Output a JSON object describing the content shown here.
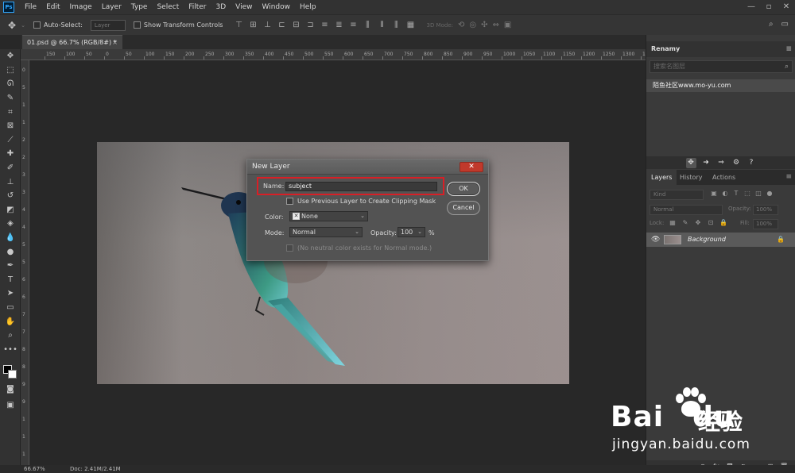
{
  "menubar": {
    "logo": "Ps",
    "items": [
      "File",
      "Edit",
      "Image",
      "Layer",
      "Type",
      "Select",
      "Filter",
      "3D",
      "View",
      "Window",
      "Help"
    ],
    "window_controls": [
      "—",
      "▫",
      "✕"
    ]
  },
  "options": {
    "auto_select_label": "Auto-Select:",
    "auto_select_value": "Layer",
    "show_transform_label": "Show Transform Controls",
    "mode_3d_label": "3D Mode:"
  },
  "document": {
    "tab_label": "01.psd @ 66.7% (RGB/8#) *",
    "tab_close": "×"
  },
  "ruler": {
    "h_ticks": [
      "150",
      "100",
      "50",
      "0",
      "50",
      "100",
      "150",
      "200",
      "250",
      "300",
      "350",
      "400",
      "450",
      "500",
      "550",
      "600",
      "650",
      "700",
      "750",
      "800",
      "850",
      "900",
      "950",
      "1000",
      "1050",
      "1100",
      "1150",
      "1200",
      "1250",
      "1300",
      "1350",
      "1400"
    ],
    "v_ticks": [
      "0",
      "5",
      "1",
      "1",
      "2",
      "2",
      "3",
      "3",
      "4",
      "4",
      "5",
      "5",
      "6",
      "6",
      "7",
      "7",
      "8",
      "8",
      "9",
      "9",
      "1",
      "1",
      "1"
    ]
  },
  "dialog": {
    "title": "New Layer",
    "close_label": "✕",
    "name_label": "Name:",
    "name_value": "subject",
    "ok_label": "OK",
    "cancel_label": "Cancel",
    "clipping_label": "Use Previous Layer to Create Clipping Mask",
    "color_label": "Color:",
    "color_value": "None",
    "mode_label": "Mode:",
    "mode_value": "Normal",
    "opacity_label": "Opacity:",
    "opacity_value": "100",
    "opacity_unit": "%",
    "neutral_label": "(No neutral color exists for Normal mode.)"
  },
  "renamy": {
    "title": "Renamy",
    "search_placeholder": "搜索名图层",
    "item": "陌鱼社区www.mo-yu.com"
  },
  "layers_panel": {
    "tabs": [
      "Layers",
      "History",
      "Actions"
    ],
    "kind_label": "Kind",
    "blend_mode": "Normal",
    "opacity_label": "Opacity:",
    "opacity_value": "100%",
    "lock_label": "Lock:",
    "fill_label": "Fill:",
    "fill_value": "100%",
    "layer_name": "Background",
    "bottom_icons": [
      "link-icon",
      "fx-icon",
      "mask-icon",
      "adjustment-icon",
      "folder-icon",
      "new-layer-icon",
      "trash-icon"
    ]
  },
  "status": {
    "zoom": "66.67%",
    "doc": "Doc: 2.41M/2.41M"
  },
  "watermark": {
    "brand": "Bai",
    "brand_tail": "du",
    "cn": "经验",
    "url": "jingyan.baidu.com"
  },
  "colors": {
    "accent_red": "#d81f26",
    "ps_blue": "#31a8ff"
  }
}
